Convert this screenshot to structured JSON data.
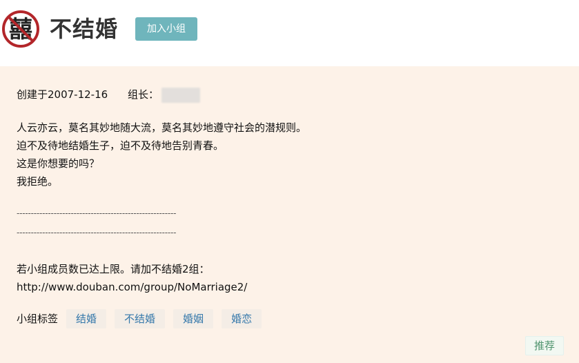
{
  "header": {
    "logo_icon": "no-marriage-logo-icon",
    "logo_char": "囍",
    "title": "不结婚",
    "join_button": "加入小组"
  },
  "info": {
    "created": "创建于2007-12-16",
    "owner_label": "组长："
  },
  "intro": {
    "lines": [
      "人云亦云，莫名其妙地随大流，莫名其妙地遵守社会的潜规则。",
      "迫不及待地结婚生子，迫不及待地告别青春。",
      "这是你想要的吗？",
      "我拒绝。"
    ]
  },
  "separators": [
    "--------------------------------------------------------",
    "--------------------------------------------------------"
  ],
  "limit": {
    "text": "若小组成员数已达上限。请加不结婚2组：",
    "url": "http://www.douban.com/group/NoMarriage2/"
  },
  "tags": {
    "label": "小组标签",
    "items": [
      "结婚",
      "不结婚",
      "婚姻",
      "婚恋"
    ]
  },
  "recommend_button": "推荐",
  "colors": {
    "join_button_bg": "#6fb5bc",
    "panel_bg": "#fdf2e8",
    "tag_text": "#3377aa",
    "logo_red": "#b3262a"
  }
}
